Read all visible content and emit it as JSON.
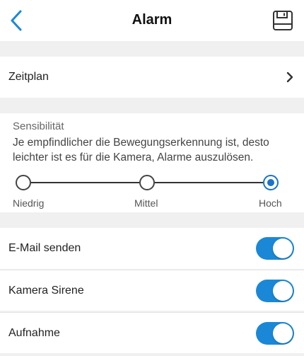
{
  "header": {
    "title": "Alarm",
    "back_icon": "chevron-left-icon",
    "save_icon": "floppy-disk-icon",
    "accent": "#1a88d6"
  },
  "schedule": {
    "label": "Zeitplan",
    "icon": "chevron-right-icon"
  },
  "sensitivity": {
    "title": "Sensibilität",
    "description": "Je empfindlicher die Bewegungserkennung ist, desto leichter ist es für die Kamera, Alarme auszulösen.",
    "stops": [
      "Niedrig",
      "Mittel",
      "Hoch"
    ],
    "selected": "Hoch",
    "selected_color": "#1a73c7"
  },
  "toggles": {
    "email": {
      "label": "E-Mail senden",
      "on": true
    },
    "siren": {
      "label": "Kamera Sirene",
      "on": true
    },
    "record": {
      "label": "Aufnahme",
      "on": true
    },
    "on_color": "#1a88d6"
  }
}
